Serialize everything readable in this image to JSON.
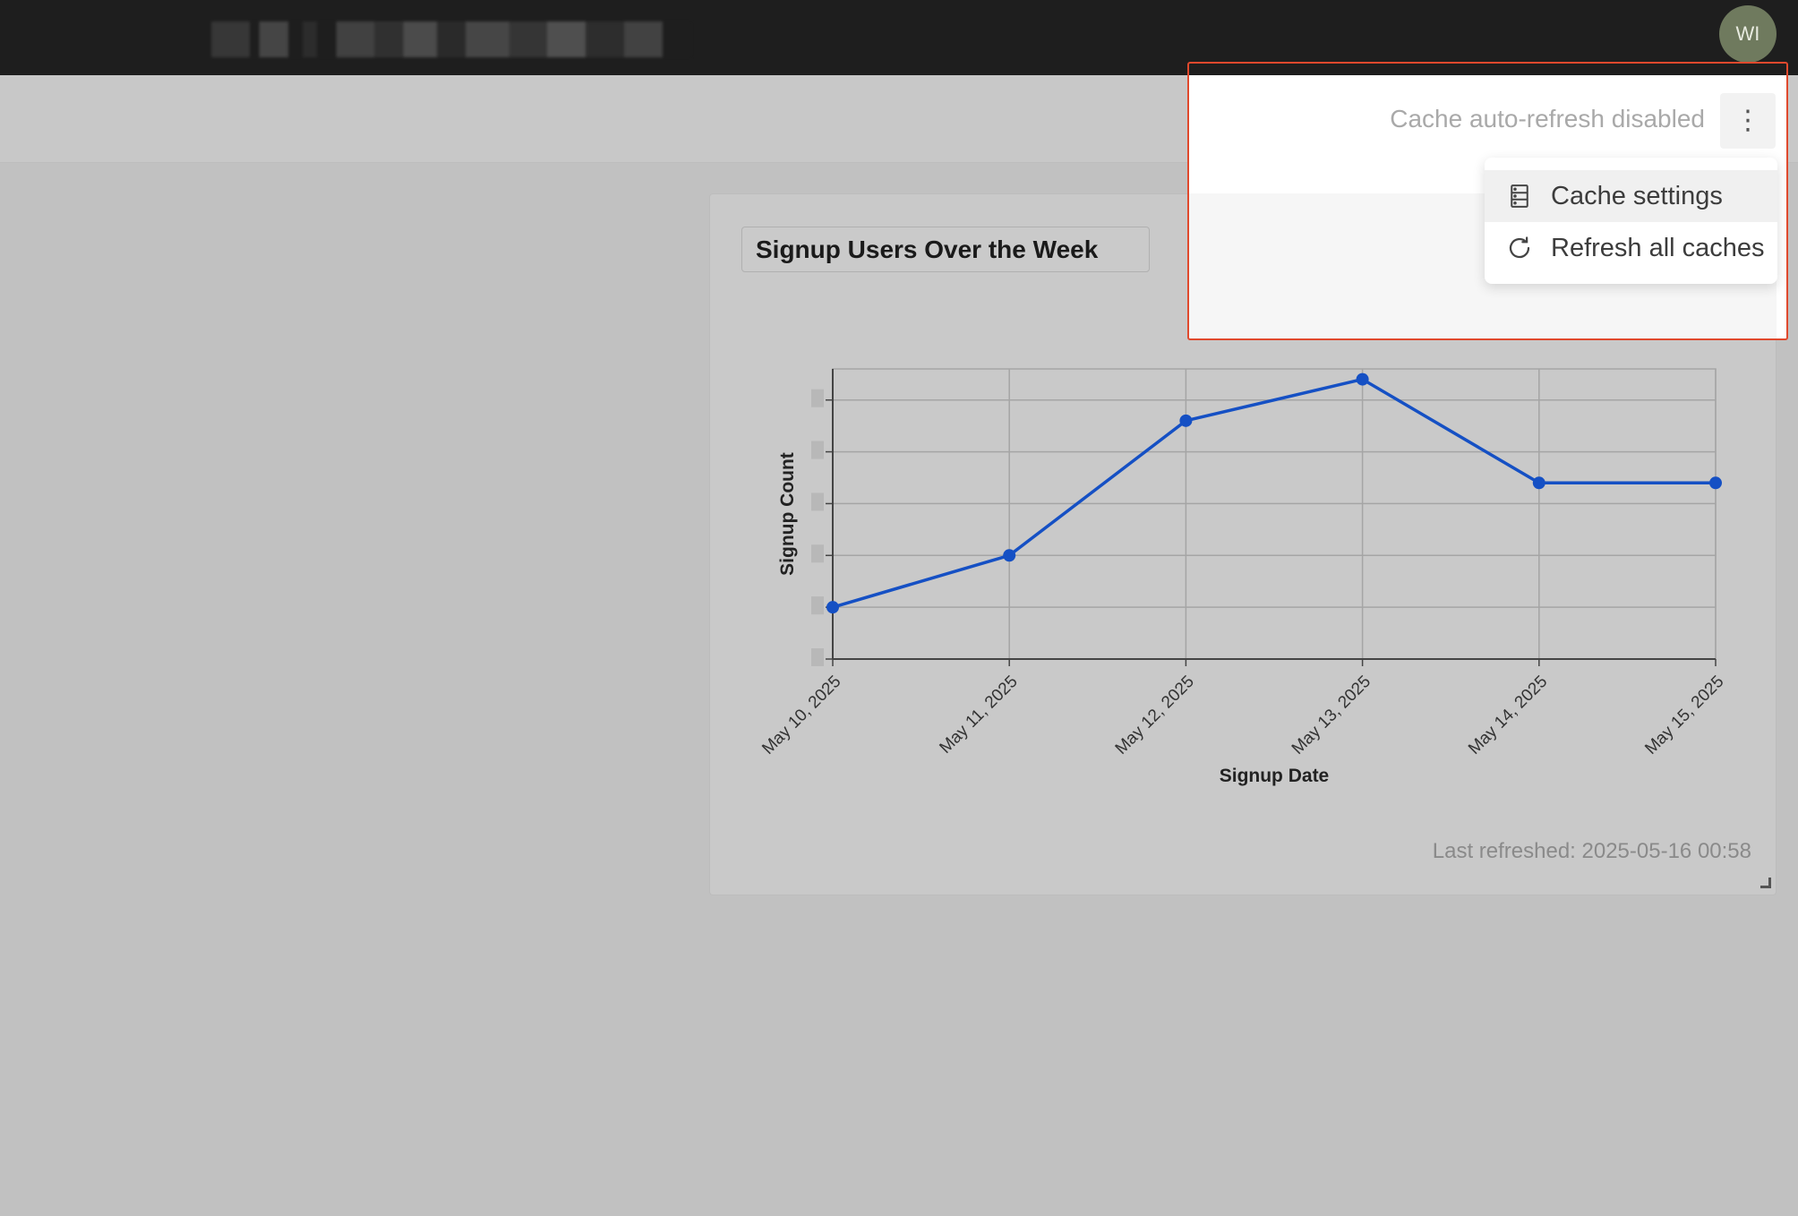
{
  "topbar": {
    "avatar_initials": "WI"
  },
  "header": {
    "cache_status": "Cache auto-refresh disabled",
    "more_menu_label": "⋮"
  },
  "menu": {
    "items": [
      {
        "label": "Cache settings",
        "icon": "server-icon"
      },
      {
        "label": "Refresh all caches",
        "icon": "refresh-icon"
      }
    ]
  },
  "card": {
    "title": "Signup Users Over the Week",
    "last_refreshed": "Last refreshed: 2025-05-16 00:58"
  },
  "chart_data": {
    "type": "line",
    "title": "Signup Users Over the Week",
    "xlabel": "Signup Date",
    "ylabel": "Signup Count",
    "x": [
      "May 10, 2025",
      "May 11, 2025",
      "May 12, 2025",
      "May 13, 2025",
      "May 14, 2025",
      "May 15, 2025"
    ],
    "series": [
      {
        "values": [
          1,
          2,
          4.6,
          5.4,
          3.4,
          3.4
        ],
        "color": "#1550c4"
      }
    ],
    "ylim": [
      0,
      5.6
    ],
    "grid": true,
    "y_tick_labels_obscured": true
  },
  "colors": {
    "accent_highlight": "#e0492d",
    "line": "#1550c4",
    "topbar": "#1e1e1e"
  }
}
